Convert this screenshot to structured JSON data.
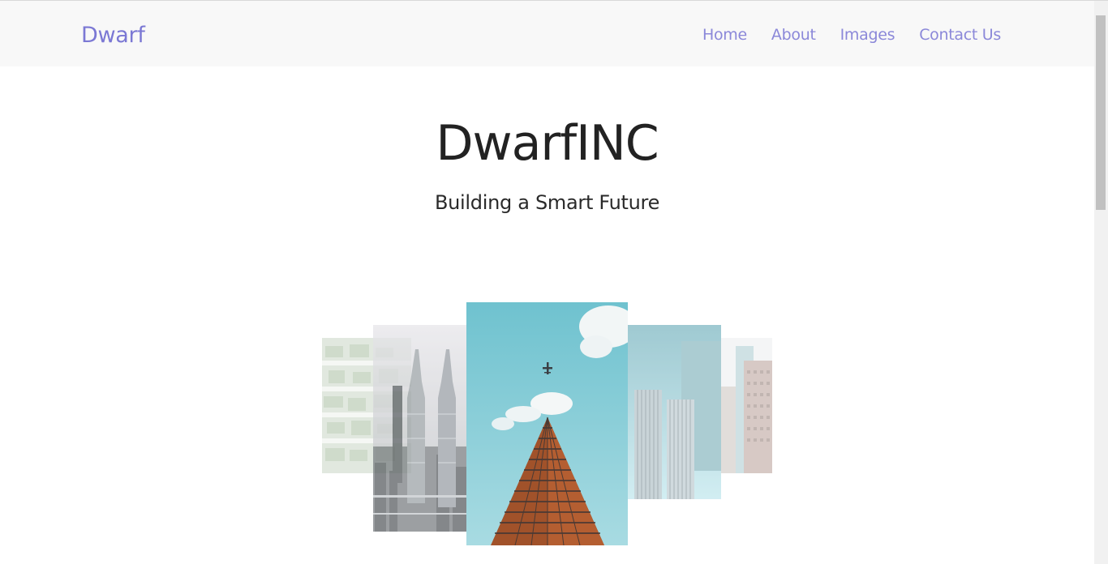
{
  "navbar": {
    "brand": "Dwarf",
    "links": [
      {
        "label": "Home"
      },
      {
        "label": "About"
      },
      {
        "label": "Images"
      },
      {
        "label": "Contact Us"
      }
    ]
  },
  "hero": {
    "title": "DwarfINC",
    "subtitle": "Building a Smart Future"
  },
  "gallery": {
    "images": [
      {
        "subject": "green-facade-building"
      },
      {
        "subject": "petronas-twin-towers"
      },
      {
        "subject": "skyscraper-with-airplane"
      },
      {
        "subject": "twin-glass-towers"
      },
      {
        "subject": "city-buildings"
      }
    ]
  },
  "colors": {
    "brand": "#7b78d4",
    "nav_link": "#8b88d9",
    "navbar_bg": "#f8f8f8",
    "title_text": "#222222"
  }
}
